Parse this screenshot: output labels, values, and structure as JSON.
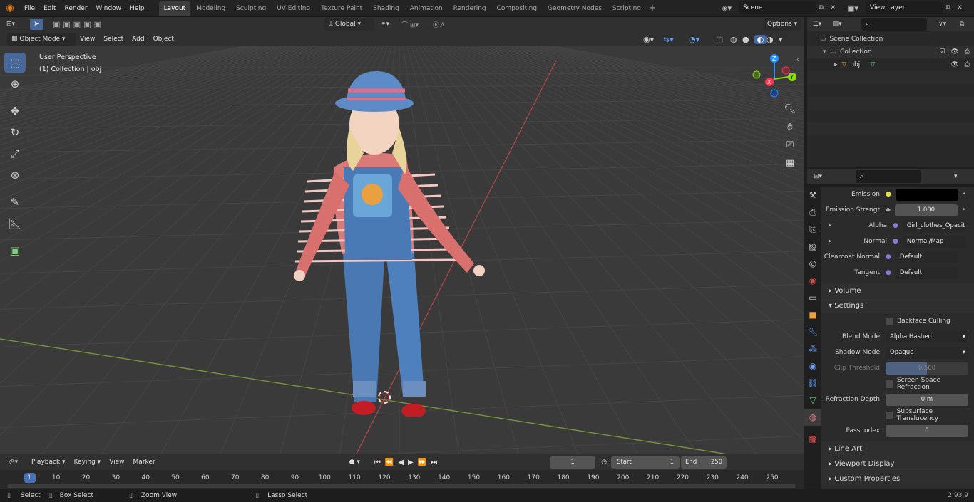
{
  "topbar": {
    "menus": [
      "File",
      "Edit",
      "Render",
      "Window",
      "Help"
    ],
    "workspaces": [
      "Layout",
      "Modeling",
      "Sculpting",
      "UV Editing",
      "Texture Paint",
      "Shading",
      "Animation",
      "Rendering",
      "Compositing",
      "Geometry Nodes",
      "Scripting"
    ],
    "active_workspace": "Layout",
    "scene": "Scene",
    "view_layer": "View Layer"
  },
  "header": {
    "orientation": "Global",
    "options_label": "Options"
  },
  "vp_header": {
    "mode": "Object Mode",
    "menus": [
      "View",
      "Select",
      "Add",
      "Object"
    ]
  },
  "viewport": {
    "title": "User Perspective",
    "subtitle": "(1) Collection | obj",
    "accent_x": "#ff3352",
    "accent_y": "#8bdc00",
    "accent_z": "#2890ff",
    "axis_x_label": "X",
    "axis_y_label": "Y",
    "axis_z_label": "Z"
  },
  "outliner": {
    "scene_collection": "Scene Collection",
    "collection": "Collection",
    "object": "obj"
  },
  "props": {
    "rows": [
      {
        "label": "Emission",
        "value": "",
        "kind": "color"
      },
      {
        "label": "Emission Strengt",
        "value": "1.000",
        "kind": "num"
      },
      {
        "label": "Alpha",
        "value": "Girl_clothes_Opacity...",
        "kind": "link"
      },
      {
        "label": "Normal",
        "value": "Normal/Map",
        "kind": "link"
      },
      {
        "label": "Clearcoat Normal",
        "value": "Default",
        "kind": "link"
      },
      {
        "label": "Tangent",
        "value": "Default",
        "kind": "link"
      }
    ],
    "volume": "Volume",
    "settings": "Settings",
    "backface": "Backface Culling",
    "blend_mode_label": "Blend Mode",
    "blend_mode": "Alpha Hashed",
    "shadow_mode_label": "Shadow Mode",
    "shadow_mode": "Opaque",
    "clip_label": "Clip Threshold",
    "clip_value": "0.500",
    "clip_fraction": 0.5,
    "ssr": "Screen Space Refraction",
    "refraction_label": "Refraction Depth",
    "refraction_value": "0 m",
    "subsurface": "Subsurface Translucency",
    "pass_label": "Pass Index",
    "pass_value": "0",
    "line_art": "Line Art",
    "viewport_display": "Viewport Display",
    "custom_props": "Custom Properties"
  },
  "timeline": {
    "menus": [
      "Playback",
      "Keying",
      "View",
      "Marker"
    ],
    "frame": "1",
    "start_label": "Start",
    "start": "1",
    "end_label": "End",
    "end": "250",
    "ticks": [
      "1",
      "10",
      "20",
      "30",
      "40",
      "50",
      "60",
      "70",
      "80",
      "90",
      "100",
      "110",
      "120",
      "130",
      "140",
      "150",
      "160",
      "170",
      "180",
      "190",
      "200",
      "210",
      "220",
      "230",
      "240",
      "250"
    ]
  },
  "status": {
    "select": "Select",
    "box_select": "Box Select",
    "zoom_view": "Zoom View",
    "lasso_select": "Lasso Select",
    "version": "2.93.9"
  }
}
